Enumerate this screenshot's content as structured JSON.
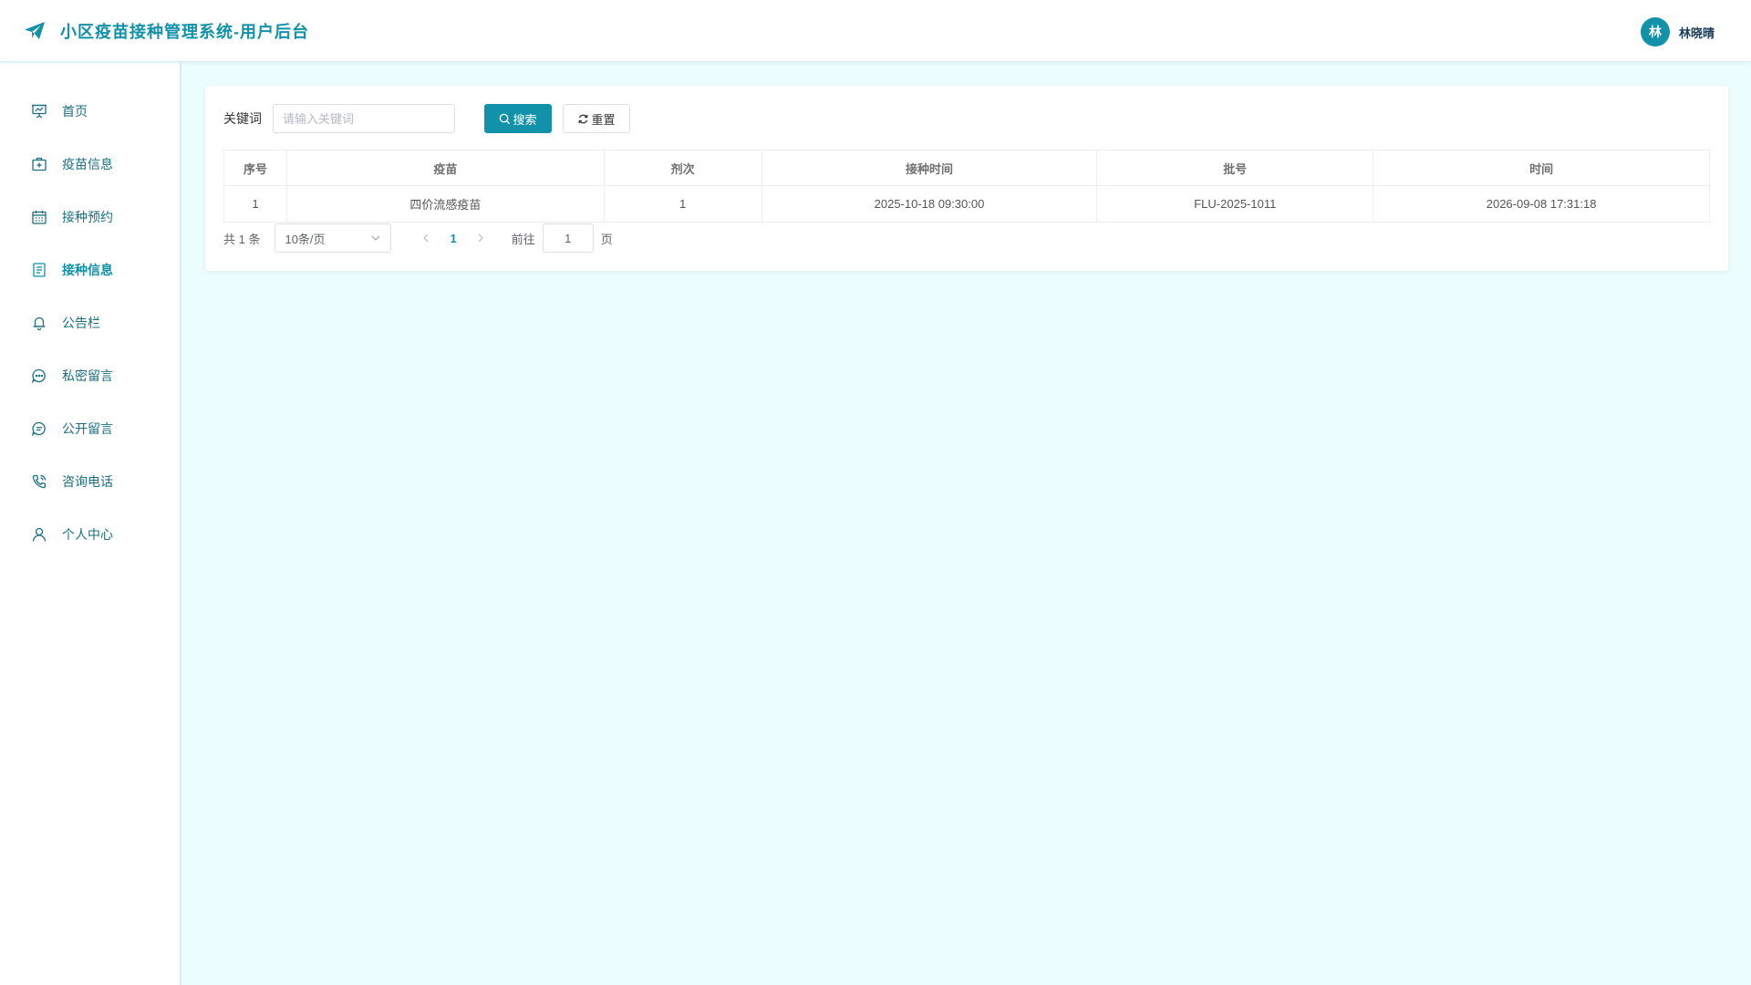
{
  "header": {
    "title": "小区疫苗接种管理系统-用户后台",
    "user": {
      "avatar_text": "林",
      "name": "林晓晴"
    }
  },
  "sidebar": {
    "items": [
      {
        "label": "首页",
        "icon": "presentation-icon"
      },
      {
        "label": "疫苗信息",
        "icon": "medical-kit-icon"
      },
      {
        "label": "接种预约",
        "icon": "calendar-icon"
      },
      {
        "label": "接种信息",
        "icon": "document-icon",
        "active": true
      },
      {
        "label": "公告栏",
        "icon": "bell-icon"
      },
      {
        "label": "私密留言",
        "icon": "chat-dots-icon"
      },
      {
        "label": "公开留言",
        "icon": "chat-lines-icon"
      },
      {
        "label": "咨询电话",
        "icon": "phone-icon"
      },
      {
        "label": "个人中心",
        "icon": "user-icon"
      }
    ]
  },
  "search": {
    "label": "关键词",
    "placeholder": "请输入关键词",
    "value": "",
    "search_button": "搜索",
    "reset_button": "重置"
  },
  "table": {
    "columns": [
      "序号",
      "疫苗",
      "剂次",
      "接种时间",
      "批号",
      "时间"
    ],
    "rows": [
      [
        "1",
        "四价流感疫苗",
        "1",
        "2025-10-18 09:30:00",
        "FLU-2025-1011",
        "2026-09-08 17:31:18"
      ]
    ]
  },
  "pagination": {
    "total_text": "共 1 条",
    "page_size": "10条/页",
    "current_page": "1",
    "goto_label": "前往",
    "goto_value": "1",
    "goto_suffix": "页"
  },
  "colors": {
    "accent": "#1292a8",
    "background": "#ecfdff"
  }
}
